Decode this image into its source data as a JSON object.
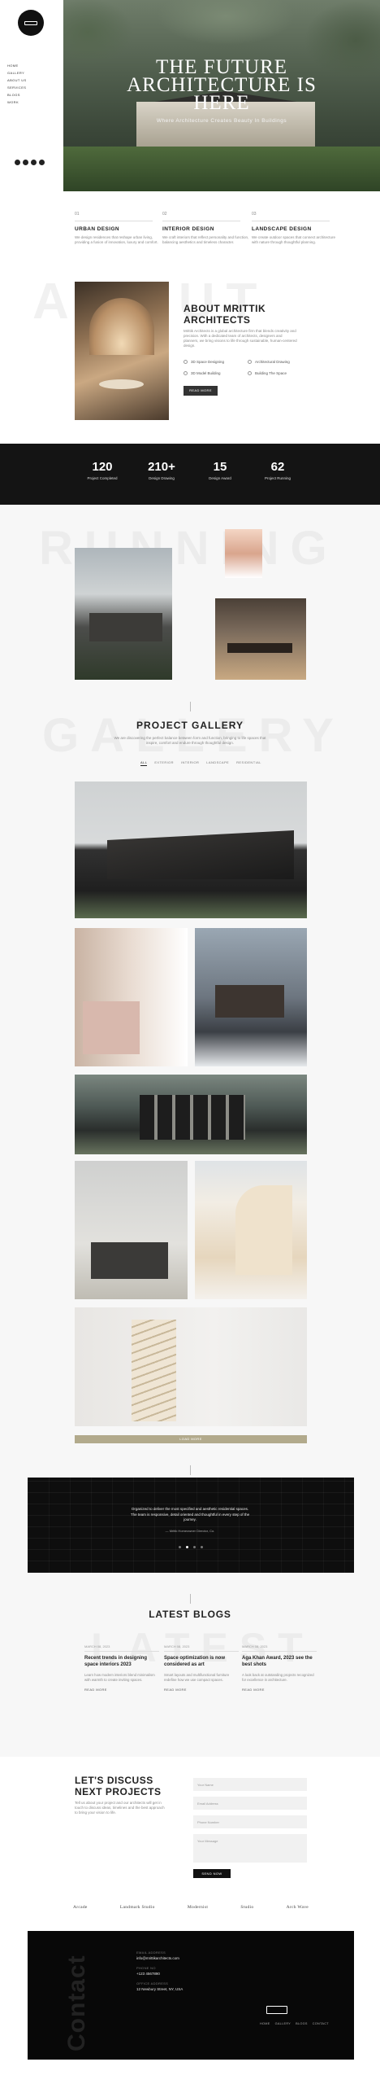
{
  "nav": [
    "Home",
    "Gallery",
    "About Us",
    "Services",
    "Blogs",
    "Work"
  ],
  "hero": {
    "title": "THE FUTURE ARCHITECTURE IS HERE",
    "subtitle": "Where Architecture Creates Beauty In Buildings"
  },
  "services": [
    {
      "num": "01",
      "title": "URBAN DESIGN",
      "text": "We design residences that reshape urban living, providing a fusion of innovation, luxury and comfort."
    },
    {
      "num": "02",
      "title": "INTERIOR DESIGN",
      "text": "We craft interiors that reflect personality and function, balancing aesthetics and timeless character."
    },
    {
      "num": "03",
      "title": "LANDSCAPE DESIGN",
      "text": "We create outdoor spaces that connect architecture with nature through thoughtful planning."
    }
  ],
  "watermarks": {
    "about": "ABOUT",
    "running": "RUNNING",
    "gallery": "GALLERY",
    "latest": "LATEST",
    "contact": "Contact"
  },
  "about": {
    "title": "ABOUT MRITTIK ARCHITECTS",
    "text": "Mrittik Architects is a global architecture firm that blends creativity and precision. With a dedicated team of architects, designers and planners, we bring visions to life through sustainable, human-centered design.",
    "features": [
      "3D Space Designing",
      "Architectural Drawing",
      "3D Model Building",
      "Building The Space"
    ],
    "button": "READ MORE"
  },
  "stats": [
    {
      "value": "120",
      "label": "Project Completed"
    },
    {
      "value": "210+",
      "label": "Design Drawing"
    },
    {
      "value": "15",
      "label": "Design Award"
    },
    {
      "value": "62",
      "label": "Project Running"
    }
  ],
  "gallery": {
    "title": "PROJECT GALLERY",
    "subtitle": "We are discovering the perfect balance between form and function, bringing to life spaces that inspire, comfort and endure through thoughtful design.",
    "tabs": [
      "All",
      "Exterior",
      "Interior",
      "Landscape",
      "Residential"
    ],
    "load_more": "LOAD MORE"
  },
  "testimonial": {
    "quote": "Organized to deliver the most specified and aesthetic residential spaces. The team is responsive, detail oriented and thoughtful in every step of the journey.",
    "author": "— Mritik Homeowner Director, Co."
  },
  "blogs": {
    "title": "LATEST BLOGS",
    "items": [
      {
        "date": "MARCH 08, 2023",
        "title": "Recent trends in designing space interiors 2023",
        "text": "Learn how modern interiors blend minimalism with warmth to create inviting spaces.",
        "more": "READ MORE"
      },
      {
        "date": "MARCH 08, 2023",
        "title": "Space optimization is now considered as art",
        "text": "Smart layouts and multifunctional furniture redefine how we use compact spaces.",
        "more": "READ MORE"
      },
      {
        "date": "MARCH 08, 2023",
        "title": "Aga Khan Award, 2023 see the best shots",
        "text": "A look back at outstanding projects recognized for excellence in architecture.",
        "more": "READ MORE"
      }
    ]
  },
  "contact": {
    "title": "LET'S DISCUSS NEXT PROJECTS",
    "text": "Tell us about your project and our architects will get in touch to discuss ideas, timelines and the best approach to bring your vision to life.",
    "fields": [
      "Your Name",
      "Email Address",
      "Phone Number",
      "Your Message"
    ],
    "send": "SEND NOW"
  },
  "partners": [
    "Arcade",
    "Landmark Studio",
    "Modernist",
    "Studio",
    "Arch Wave"
  ],
  "footer": {
    "labels": [
      "EMAIL ADDRESS",
      "PHONE NO",
      "OFFICE ADDRESS"
    ],
    "values": [
      "info@mrittikarchitects.com",
      "+123 4567890",
      "12 Newbury Street, NY, USA"
    ],
    "nav": [
      "Home",
      "Gallery",
      "Blogs",
      "Contact"
    ]
  }
}
